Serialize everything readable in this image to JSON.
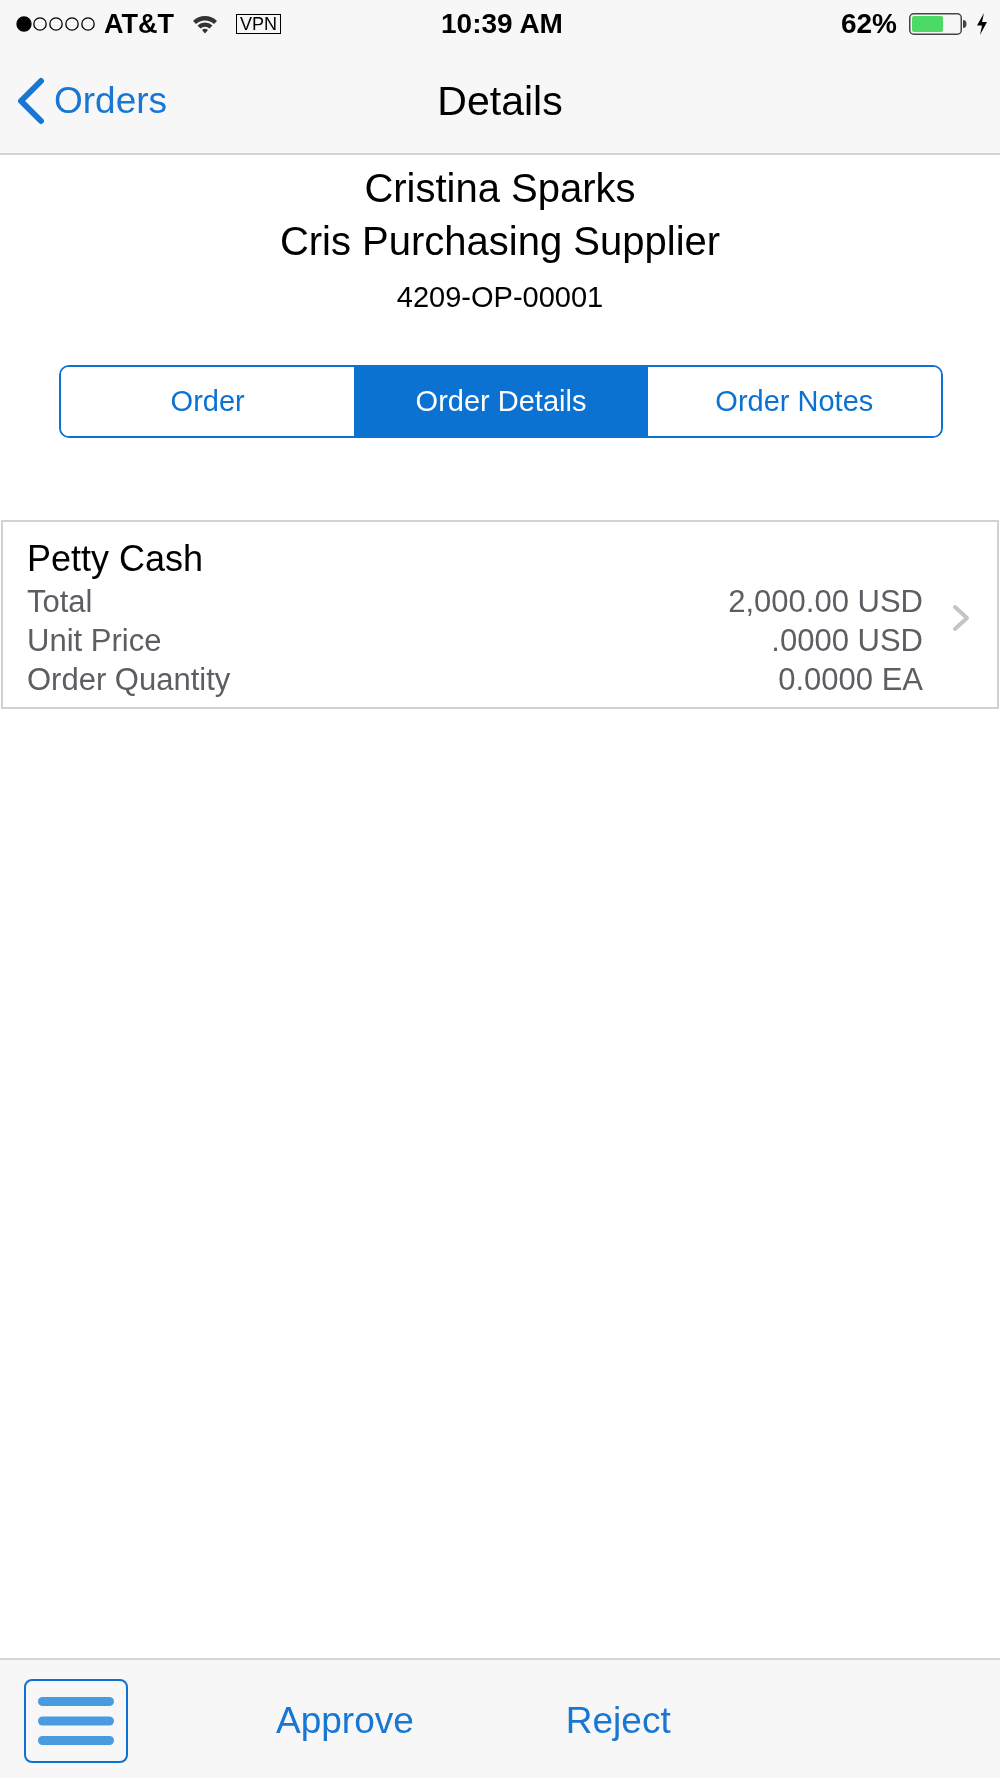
{
  "status_bar": {
    "carrier": "AT&T",
    "vpn": "VPN",
    "time": "10:39 AM",
    "battery": "62%"
  },
  "nav_bar": {
    "back_label": "Orders",
    "title": "Details"
  },
  "header": {
    "name": "Cristina Sparks",
    "company": "Cris Purchasing Supplier",
    "order_number": "4209-OP-00001"
  },
  "tabs": [
    {
      "label": "Order",
      "selected": false
    },
    {
      "label": "Order Details",
      "selected": true
    },
    {
      "label": "Order Notes",
      "selected": false
    }
  ],
  "lines": [
    {
      "title": "Petty Cash",
      "fields": [
        {
          "label": "Total",
          "value": "2,000.00 USD"
        },
        {
          "label": "Unit Price",
          "value": ".0000 USD"
        },
        {
          "label": "Order Quantity",
          "value": "0.0000 EA"
        }
      ]
    }
  ],
  "toolbar": {
    "actions": [
      "Approve",
      "Reject"
    ]
  }
}
